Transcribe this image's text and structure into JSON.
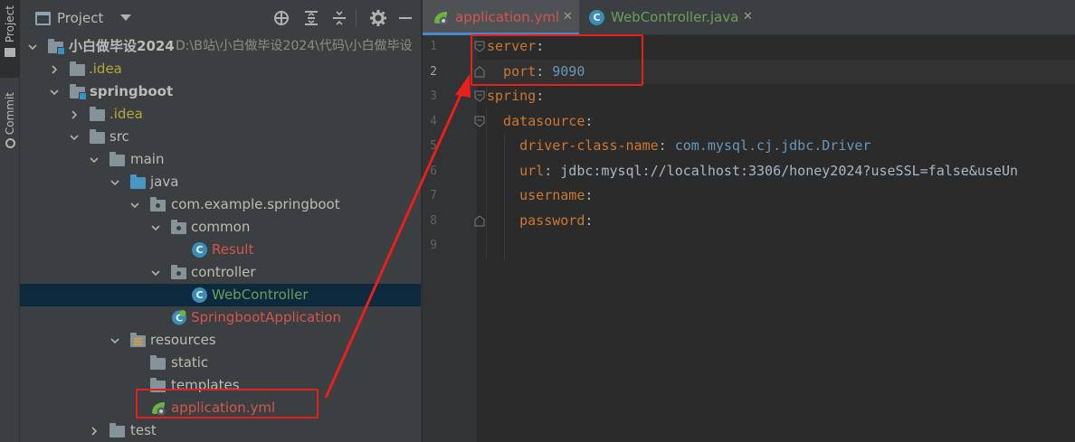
{
  "toolstrip": {
    "project_label": "Project",
    "commit_label": "Commit"
  },
  "project_panel": {
    "title": "Project",
    "tree": [
      {
        "label": "小白做毕设2024",
        "path": "D:\\B站\\小白做毕设2024\\代码\\小白做毕设",
        "kind": "module",
        "expanded": true
      },
      {
        "label": ".idea",
        "kind": "folder",
        "expanded": false,
        "color": "#b5a73c"
      },
      {
        "label": "springboot",
        "kind": "module",
        "expanded": true
      },
      {
        "label": ".idea",
        "kind": "folder",
        "expanded": false,
        "color": "#b5a73c"
      },
      {
        "label": "src",
        "kind": "folder",
        "expanded": true
      },
      {
        "label": "main",
        "kind": "folder",
        "expanded": true
      },
      {
        "label": "java",
        "kind": "source-folder",
        "expanded": true
      },
      {
        "label": "com.example.springboot",
        "kind": "package",
        "expanded": true
      },
      {
        "label": "common",
        "kind": "package",
        "expanded": true
      },
      {
        "label": "Result",
        "kind": "class",
        "color": "#d2564e"
      },
      {
        "label": "controller",
        "kind": "package",
        "expanded": true
      },
      {
        "label": "WebController",
        "kind": "class",
        "color": "#6a9f5a",
        "selected": true
      },
      {
        "label": "SpringbootApplication",
        "kind": "spring-class",
        "color": "#d2564e"
      },
      {
        "label": "resources",
        "kind": "resources-folder",
        "expanded": true
      },
      {
        "label": "static",
        "kind": "folder"
      },
      {
        "label": "templates",
        "kind": "folder"
      },
      {
        "label": "application.yml",
        "kind": "yaml",
        "color": "#d2564e"
      },
      {
        "label": "test",
        "kind": "folder",
        "expanded": false
      }
    ]
  },
  "editor": {
    "tabs": [
      {
        "label": "application.yml",
        "active": true,
        "color": "#d2564e",
        "closable": true
      },
      {
        "label": "WebController.java",
        "active": false,
        "color": "#6a9f5a",
        "closable": true
      }
    ],
    "lines": [
      {
        "n": "1",
        "tokens": [
          {
            "t": "server",
            "c": "k"
          },
          {
            "t": ":",
            "c": "t"
          }
        ]
      },
      {
        "n": "2",
        "tokens": [
          {
            "t": "  port",
            "c": "k"
          },
          {
            "t": ": ",
            "c": "t"
          },
          {
            "t": "9090",
            "c": "v"
          }
        ]
      },
      {
        "n": "3",
        "tokens": [
          {
            "t": "spring",
            "c": "k"
          },
          {
            "t": ":",
            "c": "t"
          }
        ]
      },
      {
        "n": "4",
        "tokens": [
          {
            "t": "  datasource",
            "c": "k"
          },
          {
            "t": ":",
            "c": "t"
          }
        ]
      },
      {
        "n": "5",
        "tokens": [
          {
            "t": "    driver-class-name",
            "c": "k"
          },
          {
            "t": ": ",
            "c": "t"
          },
          {
            "t": "com.mysql.cj.jdbc.Driver",
            "c": "v"
          }
        ]
      },
      {
        "n": "6",
        "tokens": [
          {
            "t": "    url",
            "c": "k"
          },
          {
            "t": ": jdbc:mysql://localhost:3306/honey2024?useSSL=false&useUn",
            "c": "t"
          }
        ]
      },
      {
        "n": "7",
        "tokens": [
          {
            "t": "    username",
            "c": "k"
          },
          {
            "t": ":",
            "c": "t"
          }
        ]
      },
      {
        "n": "8",
        "tokens": [
          {
            "t": "    password",
            "c": "k"
          },
          {
            "t": ":",
            "c": "t"
          }
        ]
      },
      {
        "n": "9",
        "tokens": []
      }
    ]
  },
  "annotation_color": "#e8201b"
}
